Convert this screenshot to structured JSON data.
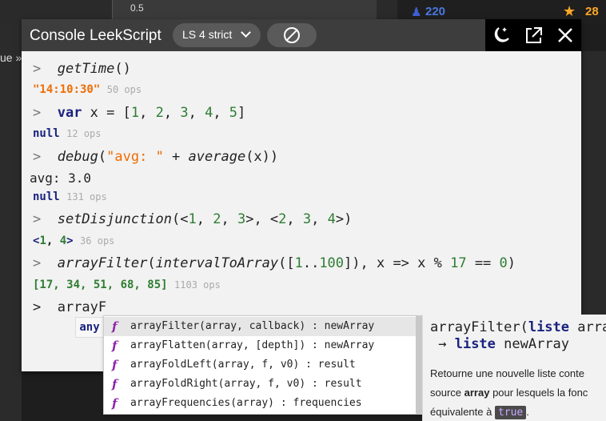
{
  "background": {
    "chart_tick": "0.5",
    "stat_leeks": "220",
    "stat_stars": "28",
    "left_text": "ue »"
  },
  "console": {
    "title": "Console LeekScript",
    "version": "LS 4 strict",
    "actions": [
      "moon-star-icon",
      "open-external-icon",
      "close-icon"
    ]
  },
  "history": {
    "gettime_cmd": "getTime",
    "gettime_paren": "()",
    "gettime_result": "\"14:10:30\"",
    "gettime_ops": "50 ops",
    "var_kw": "var",
    "var_lhs": " x = [",
    "var_items": [
      "1",
      "2",
      "3",
      "4",
      "5"
    ],
    "var_end": "]",
    "var_result": "null",
    "var_ops": "12 ops",
    "debug_fn": "debug",
    "debug_str": "\"avg: \"",
    "debug_plus": " + ",
    "debug_fn2": "average",
    "debug_arg": "(x))",
    "debug_output": "avg: 3.0",
    "debug_result": "null",
    "debug_ops": "131 ops",
    "set_fn": "setDisjunction",
    "set_a": [
      "1",
      "2",
      "3"
    ],
    "set_b": [
      "2",
      "3",
      "4"
    ],
    "set_result_open": "<",
    "set_result_items": [
      "1",
      "4"
    ],
    "set_result_close": ">",
    "set_ops": "36 ops",
    "filter_fn": "arrayFilter",
    "filter_fn2": "intervalToArray",
    "filter_from": "1",
    "filter_to": "100",
    "filter_rest": "]), x => x % ",
    "filter_mod": "17",
    "filter_eq": " == ",
    "filter_zero": "0",
    "filter_close": ")",
    "filter_result": "[17, 34, 51, 68, 85]",
    "filter_ops": "1103 ops",
    "current_input": "arrayF"
  },
  "autocomplete": {
    "type_badge": "any",
    "icon": "f",
    "items": [
      "arrayFilter(array, callback) : newArray",
      "arrayFlatten(array, [depth]) : newArray",
      "arrayFoldLeft(array, f, v0) : result",
      "arrayFoldRight(array, f, v0) : result",
      "arrayFrequencies(array) : frequencies"
    ]
  },
  "doc": {
    "sig_name": "arrayFilter(",
    "sig_kw1": "liste",
    "sig_arg": " arra",
    "sig_arrow": " → ",
    "sig_kw2": "liste",
    "sig_ret": " newArray",
    "desc_1": "Retourne une nouvelle liste conte",
    "desc_2a": "source ",
    "desc_2b": "array",
    "desc_2c": " pour lesquels la fonc",
    "desc_3a": "équivalente à ",
    "desc_3b": "true",
    "desc_3c": "."
  }
}
